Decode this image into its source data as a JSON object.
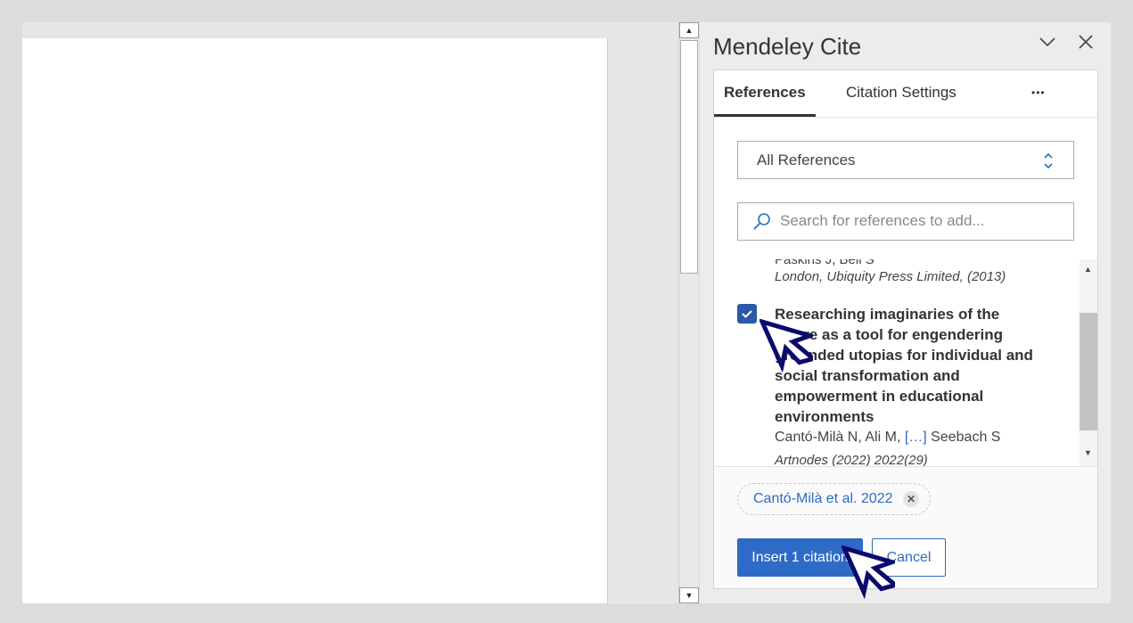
{
  "panel": {
    "title": "Mendeley Cite",
    "tabs": [
      {
        "label": "References"
      },
      {
        "label": "Citation Settings"
      }
    ],
    "more": "•••"
  },
  "filter": {
    "selected": "All References"
  },
  "search": {
    "placeholder": "Search for references to add...",
    "value": ""
  },
  "references": [
    {
      "authors": "Paskins J, Bell S",
      "source": "London, Ubiquity Press Limited, (2013)",
      "checked": false
    },
    {
      "title": "Researching imaginaries of the future as a tool for engendering grounded utopias for individual and social transformation and empowerment in educational environments",
      "authors_start": "Cantó-Milà N, Ali M,",
      "authors_more": "[…]",
      "authors_end": "Seebach S",
      "source": "Artnodes (2022) 2022(29)",
      "checked": true
    }
  ],
  "selected_chip": "Cantó-Milà et al. 2022",
  "buttons": {
    "insert": "Insert 1 citation",
    "cancel": "Cancel"
  },
  "colors": {
    "accent": "#2e6bc6",
    "checkbox": "#2a5aa8",
    "cursor": "#0a0a6e"
  }
}
